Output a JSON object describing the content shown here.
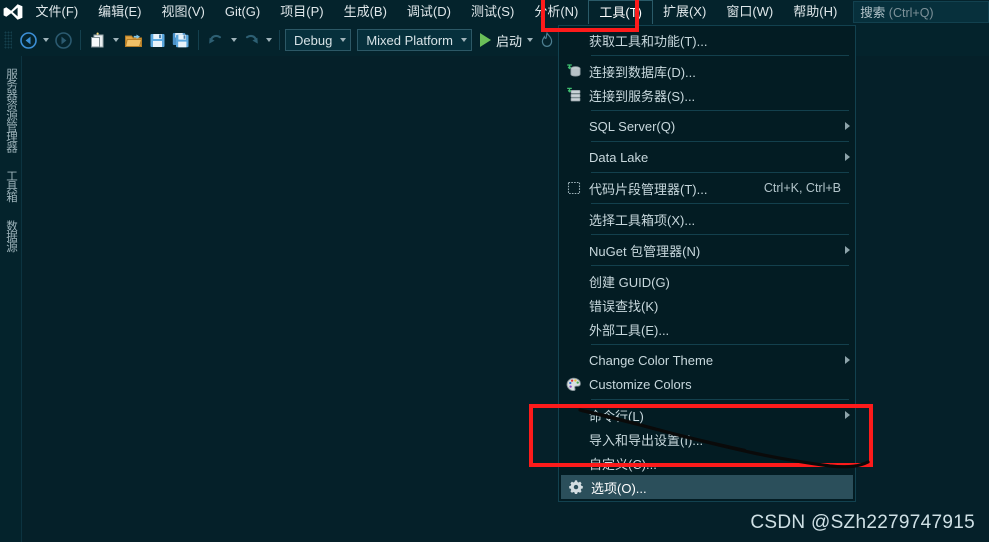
{
  "window": {
    "app": "Visual Studio",
    "background_color": "#052029",
    "accent_color": "#fd1b1b"
  },
  "menubar": {
    "logo_icon": "visual-studio-logo-icon",
    "items": [
      {
        "label": "文件(F)",
        "active": false
      },
      {
        "label": "编辑(E)",
        "active": false
      },
      {
        "label": "视图(V)",
        "active": false
      },
      {
        "label": "Git(G)",
        "active": false
      },
      {
        "label": "项目(P)",
        "active": false
      },
      {
        "label": "生成(B)",
        "active": false
      },
      {
        "label": "调试(D)",
        "active": false
      },
      {
        "label": "测试(S)",
        "active": false
      },
      {
        "label": "分析(N)",
        "active": false
      },
      {
        "label": "工具(T)",
        "active": true
      },
      {
        "label": "扩展(X)",
        "active": false
      },
      {
        "label": "窗口(W)",
        "active": false
      },
      {
        "label": "帮助(H)",
        "active": false
      }
    ],
    "search": {
      "placeholder_main": "搜索",
      "placeholder_sub": " (Ctrl+Q)",
      "value": ""
    }
  },
  "toolbar": {
    "back_icon": "navigate-back-icon",
    "forward_icon": "navigate-forward-icon",
    "new_project_icon": "new-project-icon",
    "open_file_icon": "open-folder-icon",
    "save_icon": "save-icon",
    "save_all_icon": "save-all-icon",
    "undo_icon": "undo-icon",
    "redo_icon": "redo-icon",
    "configuration": "Debug",
    "platform": "Mixed Platform",
    "start_label": "启动",
    "start_icon": "play-icon",
    "hot_reload_icon": "hot-reload-flame-icon"
  },
  "left_rail": {
    "tabs": [
      {
        "label": "服务器资源管理器"
      },
      {
        "label": "工具箱"
      },
      {
        "label": "数据源"
      }
    ]
  },
  "tools_menu": {
    "rows": [
      {
        "type": "item",
        "label": "获取工具和功能(T)...",
        "icon": "",
        "shortcut": "",
        "submenu": false,
        "selected": false,
        "occluded": true
      },
      {
        "type": "separator"
      },
      {
        "type": "item",
        "label": "连接到数据库(D)...",
        "icon": "connect-database-icon",
        "shortcut": "",
        "submenu": false,
        "selected": false
      },
      {
        "type": "item",
        "label": "连接到服务器(S)...",
        "icon": "connect-server-icon",
        "shortcut": "",
        "submenu": false,
        "selected": false
      },
      {
        "type": "separator"
      },
      {
        "type": "item",
        "label": "SQL Server(Q)",
        "icon": "",
        "shortcut": "",
        "submenu": true,
        "selected": false
      },
      {
        "type": "separator"
      },
      {
        "type": "item",
        "label": "Data Lake",
        "icon": "",
        "shortcut": "",
        "submenu": true,
        "selected": false
      },
      {
        "type": "separator"
      },
      {
        "type": "item",
        "label": "代码片段管理器(T)...",
        "icon": "code-snippet-icon",
        "shortcut": "Ctrl+K, Ctrl+B",
        "submenu": false,
        "selected": false
      },
      {
        "type": "separator"
      },
      {
        "type": "item",
        "label": "选择工具箱项(X)...",
        "icon": "",
        "shortcut": "",
        "submenu": false,
        "selected": false
      },
      {
        "type": "separator"
      },
      {
        "type": "item",
        "label": "NuGet 包管理器(N)",
        "icon": "",
        "shortcut": "",
        "submenu": true,
        "selected": false
      },
      {
        "type": "separator"
      },
      {
        "type": "item",
        "label": "创建 GUID(G)",
        "icon": "",
        "shortcut": "",
        "submenu": false,
        "selected": false
      },
      {
        "type": "item",
        "label": "错误查找(K)",
        "icon": "",
        "shortcut": "",
        "submenu": false,
        "selected": false
      },
      {
        "type": "item",
        "label": "外部工具(E)...",
        "icon": "",
        "shortcut": "",
        "submenu": false,
        "selected": false
      },
      {
        "type": "separator"
      },
      {
        "type": "item",
        "label": "Change Color Theme",
        "icon": "",
        "shortcut": "",
        "submenu": true,
        "selected": false
      },
      {
        "type": "item",
        "label": "Customize Colors",
        "icon": "color-palette-icon",
        "shortcut": "",
        "submenu": false,
        "selected": false
      },
      {
        "type": "separator"
      },
      {
        "type": "item",
        "label": "命令行(L)",
        "icon": "",
        "shortcut": "",
        "submenu": true,
        "selected": false
      },
      {
        "type": "item",
        "label": "导入和导出设置(I)...",
        "icon": "",
        "shortcut": "",
        "submenu": false,
        "selected": false
      },
      {
        "type": "item",
        "label": "自定义(C)...",
        "icon": "",
        "shortcut": "",
        "submenu": false,
        "selected": false,
        "occluded": true
      },
      {
        "type": "item",
        "label": "选项(O)...",
        "icon": "gear-icon",
        "shortcut": "",
        "submenu": false,
        "selected": true
      }
    ]
  },
  "annotations": {
    "highlight_tools_menu": "工具(T)",
    "highlight_options_item": "选项(O)...",
    "scribble": "black-strikethrough-scribble"
  },
  "watermark": {
    "text": "CSDN @SZh2279747915"
  }
}
